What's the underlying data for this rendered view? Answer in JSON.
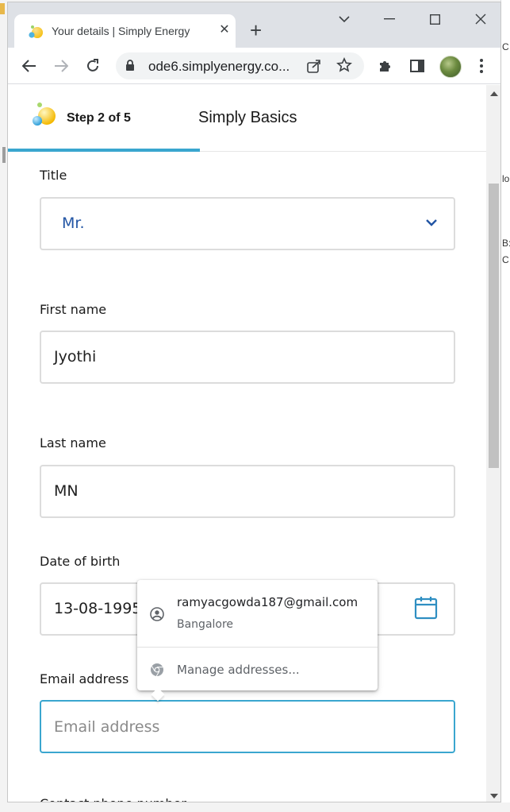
{
  "browser": {
    "tab_title": "Your details | Simply Energy",
    "url": "ode6.simplyenergy.co..."
  },
  "stepper": {
    "step_label": "Step 2 of 5",
    "plan_name": "Simply Basics",
    "progress_fraction": 0.4
  },
  "form": {
    "title": {
      "label": "Title",
      "value": "Mr."
    },
    "first_name": {
      "label": "First name",
      "value": "Jyothi"
    },
    "last_name": {
      "label": "Last name",
      "value": "MN"
    },
    "dob": {
      "label": "Date of birth",
      "value": "13-08-1995"
    },
    "email": {
      "label": "Email address",
      "placeholder": "Email address"
    },
    "phone": {
      "label": "Contact phone number"
    }
  },
  "autofill": {
    "suggestion_email": "ramyacgowda187@gmail.com",
    "suggestion_city": "Bangalore",
    "manage_label": "Manage addresses..."
  },
  "colors": {
    "accent": "#3aa6cf",
    "select_text": "#2255a4"
  }
}
